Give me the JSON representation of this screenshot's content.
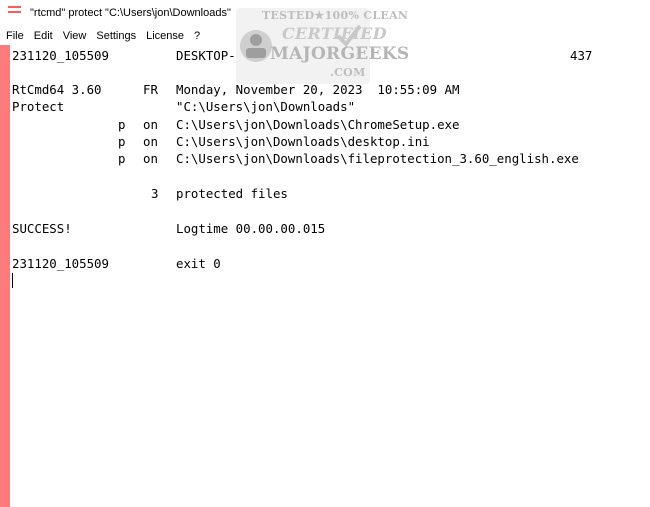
{
  "window": {
    "title": "\"rtcmd\" protect \"C:\\Users\\jon\\Downloads\"",
    "icon": "notepad-icon"
  },
  "menu": [
    "File",
    "Edit",
    "View",
    "Settings",
    "License",
    "?"
  ],
  "watermark": {
    "line1": "TESTED★100% CLEAN",
    "line2": "CERTIFIED",
    "line3": "MAJORGEEKS",
    "line4": ".COM"
  },
  "log": {
    "header_id": "231120_105509",
    "header_host": "DESKTOP-",
    "header_num": "437",
    "app_version": "RtCmd64 3.60",
    "lang": "FR",
    "datetime": "Monday, November 20, 2023  10:55:09 AM",
    "action": "Protect",
    "target": "\"C:\\Users\\jon\\Downloads\"",
    "files": [
      {
        "flag": "p",
        "state": "on",
        "path": "C:\\Users\\jon\\Downloads\\ChromeSetup.exe"
      },
      {
        "flag": "p",
        "state": "on",
        "path": "C:\\Users\\jon\\Downloads\\desktop.ini"
      },
      {
        "flag": "p",
        "state": "on",
        "path": "C:\\Users\\jon\\Downloads\\fileprotection_3.60_english.exe"
      }
    ],
    "count": "3",
    "count_label": "protected files",
    "result": "SUCCESS!",
    "logtime": "Logtime 00.00.00.015",
    "footer_id": "231120_105509",
    "exit": "exit 0"
  }
}
